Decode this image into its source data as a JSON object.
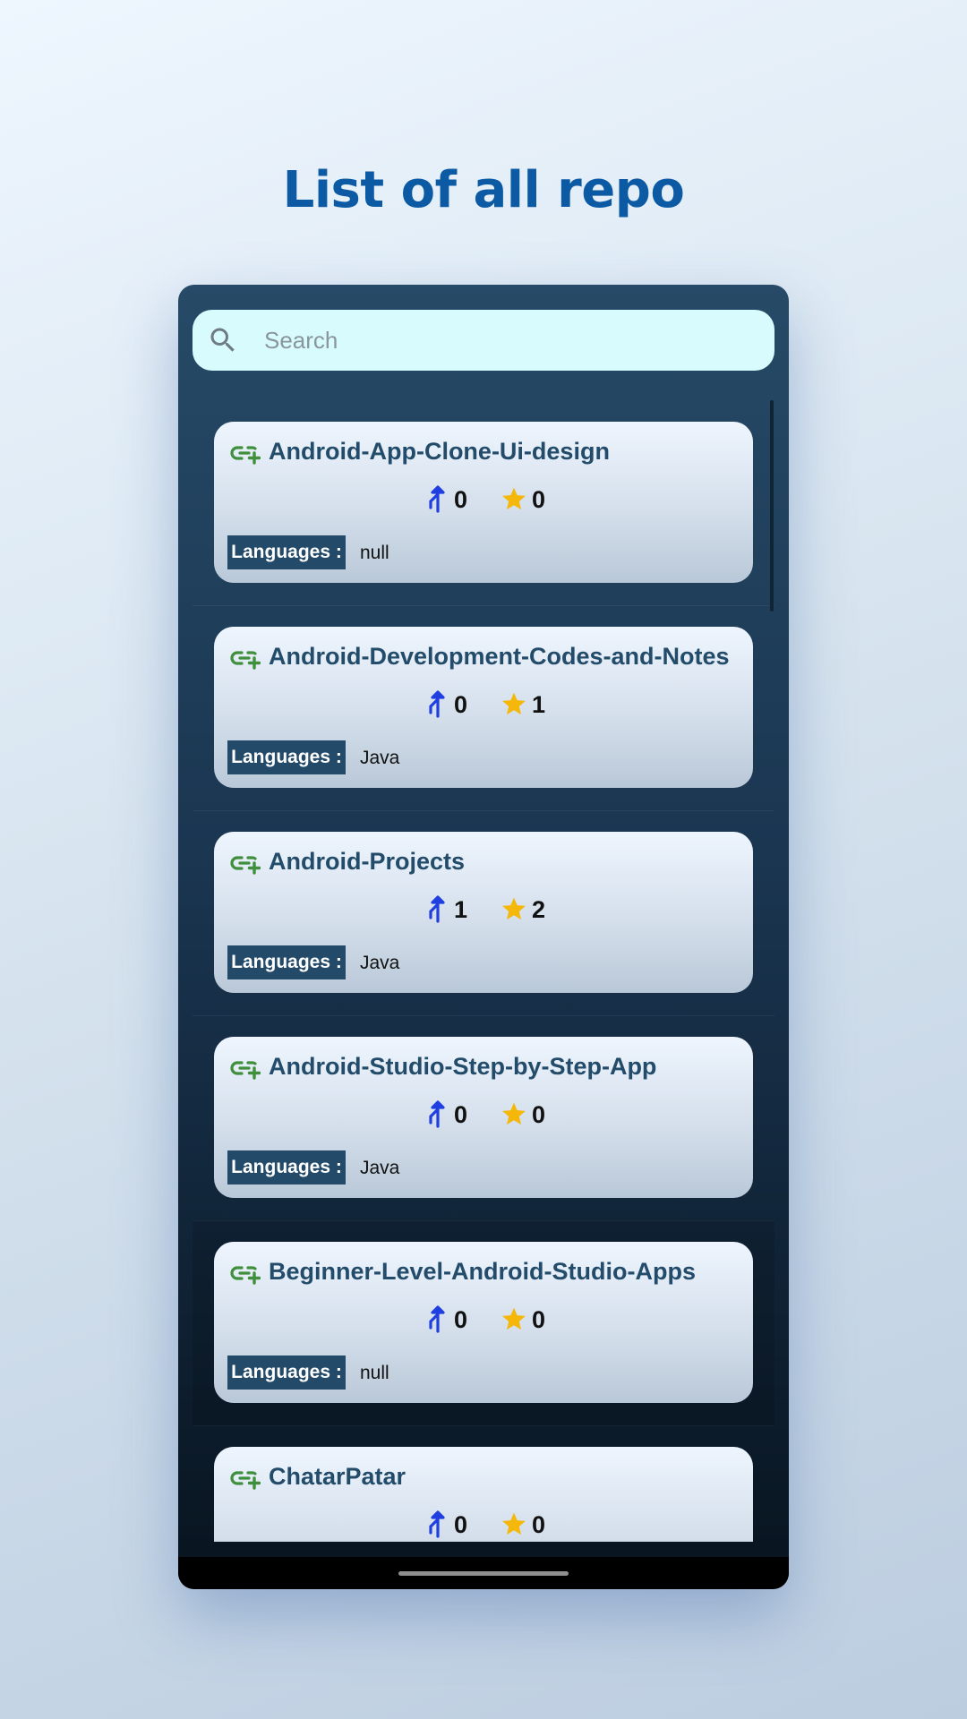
{
  "page": {
    "title": "List of all repo"
  },
  "search": {
    "placeholder": "Search"
  },
  "labels": {
    "languages": "Languages :"
  },
  "colors": {
    "title": "#0b5aa3",
    "fork_icon": "#1f3fe0",
    "star_icon": "#f4b70a",
    "repo_icon": "#3f8f3d",
    "language_badge": "#234a69",
    "search_bg": "#d8fcfd"
  },
  "icons": {
    "search": "search-icon",
    "repo": "repo-link-icon",
    "fork": "fork-icon",
    "star": "star-icon"
  },
  "repos": [
    {
      "name": "Android-App-Clone-Ui-design",
      "forks": "0",
      "stars": "0",
      "language": "null"
    },
    {
      "name": "Android-Development-Codes-and-Notes",
      "forks": "0",
      "stars": "1",
      "language": "Java"
    },
    {
      "name": "Android-Projects",
      "forks": "1",
      "stars": "2",
      "language": "Java"
    },
    {
      "name": "Android-Studio-Step-by-Step-App",
      "forks": "0",
      "stars": "0",
      "language": "Java"
    },
    {
      "name": "Beginner-Level-Android-Studio-Apps",
      "forks": "0",
      "stars": "0",
      "language": "null"
    },
    {
      "name": "ChatarPatar",
      "forks": "0",
      "stars": "0",
      "language": ""
    }
  ]
}
